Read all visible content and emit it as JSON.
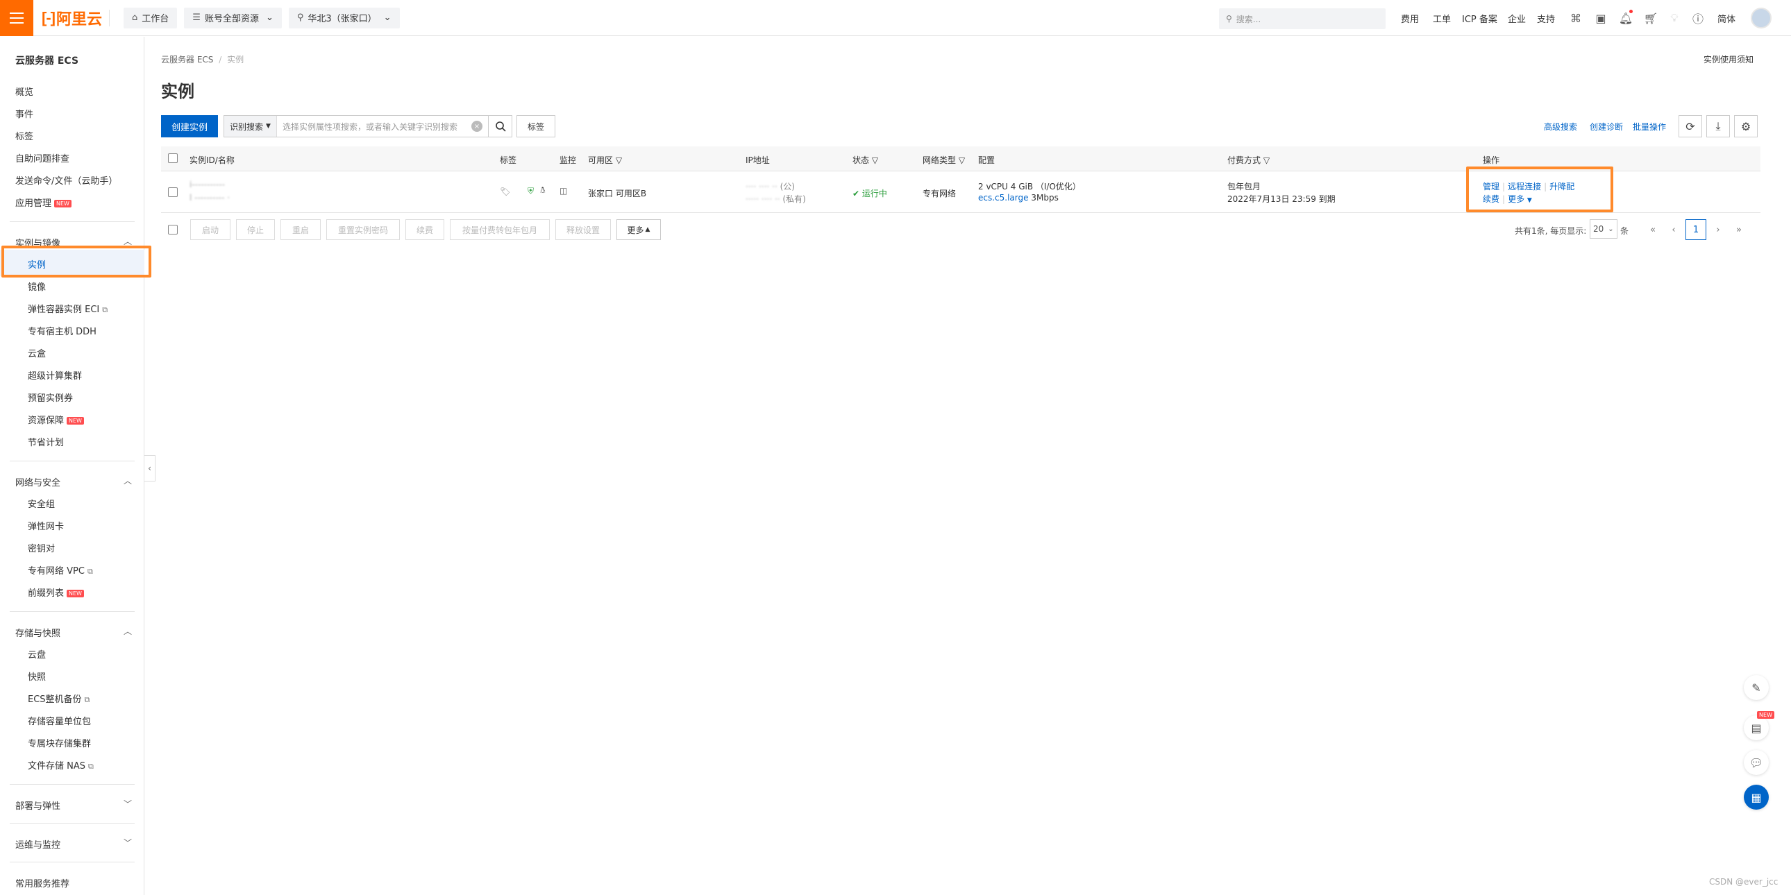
{
  "header": {
    "logo_text": "阿里云",
    "workbench": "工作台",
    "account": "账号全部资源",
    "region": "华北3（张家口）",
    "search_placeholder": "搜索...",
    "nav": [
      "费用",
      "工单",
      "ICP 备案",
      "企业",
      "支持"
    ],
    "language": "简体"
  },
  "sidebar": {
    "title": "云服务器 ECS",
    "top_items": [
      "概览",
      "事件",
      "标签",
      "自助问题排查",
      "发送命令/文件（云助手）",
      "应用管理"
    ],
    "app_mgmt_tag": "NEW",
    "groups": [
      {
        "label": "实例与镜像",
        "items": [
          "实例",
          "镜像",
          "弹性容器实例 ECI",
          "专有宿主机 DDH",
          "云盒",
          "超级计算集群",
          "预留实例券",
          "资源保障",
          "节省计划"
        ]
      },
      {
        "label": "网络与安全",
        "items": [
          "安全组",
          "弹性网卡",
          "密钥对",
          "专有网络 VPC",
          "前缀列表"
        ]
      },
      {
        "label": "存储与快照",
        "items": [
          "云盘",
          "快照",
          "ECS整机备份",
          "存储容量单位包",
          "专属块存储集群",
          "文件存储 NAS"
        ]
      },
      {
        "label": "部署与弹性"
      },
      {
        "label": "运维与监控"
      },
      {
        "label": "常用服务推荐"
      }
    ],
    "new_tag": "NEW"
  },
  "breadcrumb": {
    "root": "云服务器 ECS",
    "sep": "/",
    "current": "实例"
  },
  "page": {
    "title": "实例",
    "notice_link": "实例使用须知"
  },
  "toolbar": {
    "create": "创建实例",
    "filter_select": "识别搜索",
    "filter_placeholder": "选择实例属性项搜索，或者输入关键字识别搜索",
    "tag_btn": "标签",
    "adv_search": "高级搜索",
    "diagnose": "创建诊断",
    "batch": "批量操作"
  },
  "table": {
    "columns": [
      "实例ID/名称",
      "标签",
      "监控",
      "可用区",
      "IP地址",
      "状态",
      "网络类型",
      "配置",
      "付费方式",
      "操作"
    ],
    "row": {
      "zone": "张家口 可用区B",
      "ip_public_suffix": "(公)",
      "ip_private_suffix": "(私有)",
      "status": "运行中",
      "network": "专有网络",
      "config_line1": "2 vCPU 4 GiB （I/O优化）",
      "config_type": "ecs.c5.large",
      "config_bw": "3Mbps",
      "pay_type": "包年包月",
      "expire": "2022年7月13日 23:59 到期",
      "ops": [
        "管理",
        "远程连接",
        "升降配",
        "续费",
        "更多"
      ]
    }
  },
  "bottom_actions": [
    "启动",
    "停止",
    "重启",
    "重置实例密码",
    "续费",
    "按量付费转包年包月",
    "释放设置",
    "更多"
  ],
  "pagination": {
    "summary": "共有1条, 每页显示:",
    "page_size": "20",
    "unit": "条",
    "current_page": "1"
  },
  "watermark": "CSDN @ever_jcc",
  "float_new_tag": "NEW"
}
